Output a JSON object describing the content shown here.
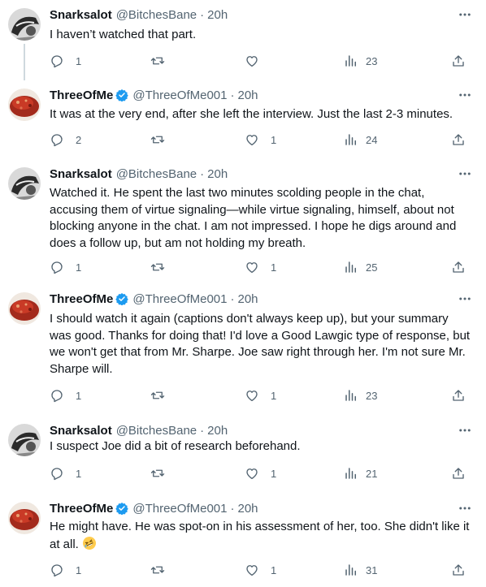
{
  "tweets": [
    {
      "name": "Snarksalot",
      "handle": "@BitchesBane",
      "time": "20h",
      "text": "I haven’t watched that part.",
      "replies": "1",
      "retweets": "",
      "likes": "",
      "views": "23",
      "avatar": "gray-bw"
    },
    {
      "name": "ThreeOfMe",
      "handle": "@ThreeOfMe001",
      "time": "20h",
      "text": "It was at the very end, after she left the interview. Just the last 2-3 minutes.",
      "replies": "2",
      "retweets": "",
      "likes": "1",
      "views": "24",
      "avatar": "red-meatloaf"
    },
    {
      "name": "Snarksalot",
      "handle": "@BitchesBane",
      "time": "20h",
      "text": "Watched it. He spent the last two minutes scolding people in the chat, accusing them of virtue signaling—while virtue signaling, himself, about not blocking anyone in the chat. I am not impressed. I hope he digs around and does a follow up, but am not holding my breath.",
      "replies": "1",
      "retweets": "",
      "likes": "1",
      "views": "25",
      "avatar": "gray-bw"
    },
    {
      "name": "ThreeOfMe",
      "handle": "@ThreeOfMe001",
      "time": "20h",
      "text": "I should watch it again (captions don't always keep up), but your summary was good. Thanks for doing that! I'd love a Good Lawgic type of response, but we won't get that from Mr. Sharpe. Joe saw right through her. I'm not sure Mr. Sharpe will.",
      "replies": "1",
      "retweets": "",
      "likes": "1",
      "views": "23",
      "avatar": "red-meatloaf"
    },
    {
      "name": "Snarksalot",
      "handle": "@BitchesBane",
      "time": "20h",
      "text": "I suspect Joe did a bit of research beforehand.",
      "replies": "1",
      "retweets": "",
      "likes": "1",
      "views": "21",
      "avatar": "gray-bw"
    },
    {
      "name": "ThreeOfMe",
      "handle": "@ThreeOfMe001",
      "time": "20h",
      "text": "He might have. He was spot-on in his assessment of her, too. She didn't like it at all.",
      "text_emoji": "rolling-on-floor-laughing-emoji",
      "replies": "1",
      "retweets": "",
      "likes": "1",
      "views": "31",
      "avatar": "red-meatloaf"
    }
  ],
  "colors": {
    "text": "#0f1419",
    "secondary": "#536471",
    "verified": "#1d9bf0",
    "thread_line": "#cfd9de"
  },
  "icons": [
    "more-icon",
    "reply-icon",
    "retweet-icon",
    "like-icon",
    "views-icon",
    "share-icon",
    "verified-badge-icon"
  ]
}
